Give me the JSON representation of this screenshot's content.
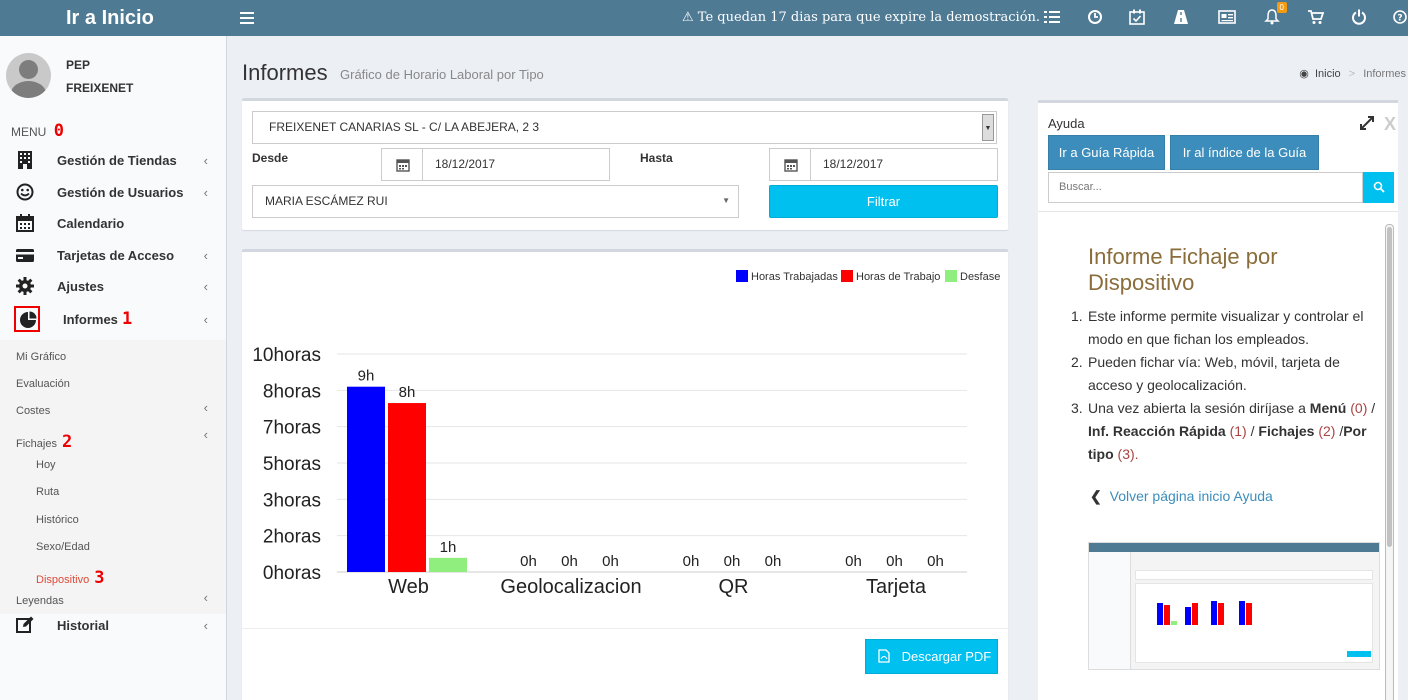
{
  "topbar": {
    "brand": "Ir a Inicio",
    "trial_notice": "Te quedan 17 dias para que expire la demostración.",
    "notification_count": "0"
  },
  "user": {
    "name": "PEP",
    "company": "FREIXENET"
  },
  "sidebar": {
    "menu_label": "MENU",
    "menu_marker": "0",
    "items": [
      {
        "label": "Gestión de Tiendas"
      },
      {
        "label": "Gestión de Usuarios"
      },
      {
        "label": "Calendario"
      },
      {
        "label": "Tarjetas de Acceso"
      },
      {
        "label": "Ajustes"
      },
      {
        "label": "Informes",
        "marker": "1"
      },
      {
        "label": "Historial"
      }
    ],
    "sub_items": [
      "Mi Gráfico",
      "Evaluación",
      "Costes",
      "Fichajes",
      "Leyendas"
    ],
    "fichajes_marker": "2",
    "fichajes_sub": [
      "Hoy",
      "Ruta",
      "Histórico",
      "Sexo/Edad",
      "Dispositivo"
    ],
    "dispositivo_marker": "3"
  },
  "page": {
    "title": "Informes",
    "subtitle": "Gráfico de Horario Laboral por Tipo",
    "breadcrumb_home": "Inicio",
    "breadcrumb_sep": ">",
    "breadcrumb_current": "Informes"
  },
  "filters": {
    "store": "FREIXENET CANARIAS SL - C/ LA ABEJERA, 2 3",
    "from_label": "Desde",
    "from_value": "18/12/2017",
    "to_label": "Hasta",
    "to_value": "18/12/2017",
    "employee": "MARIA ESCÁMEZ RUI",
    "filter_button": "Filtrar"
  },
  "download_button": "Descargar PDF",
  "chart_data": {
    "type": "bar",
    "categories": [
      "Web",
      "Geolocalizacion",
      "QR",
      "Tarjeta"
    ],
    "series": [
      {
        "name": "Horas Trabajadas",
        "color": "#0000ff",
        "values": [
          8.5,
          0,
          0,
          0
        ],
        "labels": [
          "9h",
          "0h",
          "0h",
          "0h"
        ]
      },
      {
        "name": "Horas de Trabajo",
        "color": "#ff0000",
        "values": [
          7.75,
          0,
          0,
          0
        ],
        "labels": [
          "8h",
          "0h",
          "0h",
          "0h"
        ]
      },
      {
        "name": "Desfase",
        "color": "#90ee7e",
        "values": [
          0.65,
          0,
          0,
          0
        ],
        "labels": [
          "1h",
          "0h",
          "0h",
          "0h"
        ]
      }
    ],
    "yticks": [
      "0horas",
      "2horas",
      "3horas",
      "5horas",
      "7horas",
      "8horas",
      "10horas"
    ],
    "ylim": [
      0,
      10
    ],
    "legend_position": "top-right",
    "grid": true
  },
  "help": {
    "title": "Ayuda",
    "btn_quick": "Ir a Guía Rápida",
    "btn_index": "Ir al índice de la Guía",
    "search_placeholder": "Buscar...",
    "close_label": "X",
    "doc_title": "Informe Fichaje por Dispositivo",
    "step1_num": "1.",
    "step1": "Este informe permite visualizar y controlar el modo en que fichan los empleados.",
    "step2_num": "2.",
    "step2": "Pueden fichar vía: Web, móvil, tarjeta de acceso y geolocalización.",
    "step3_num": "3.",
    "step3_a": "Una vez abierta la sesión diríjase a",
    "step3_menu": "Menú",
    "step3_ref0": "(0)",
    "step3_inf": "Inf. Reacción Rápida",
    "step3_ref1": "(1)",
    "step3_fich": "Fichajes",
    "step3_ref2": "(2)",
    "step3_tipo": "Por tipo",
    "step3_ref3": "(3).",
    "back_link": "Volver página inicio Ayuda"
  }
}
